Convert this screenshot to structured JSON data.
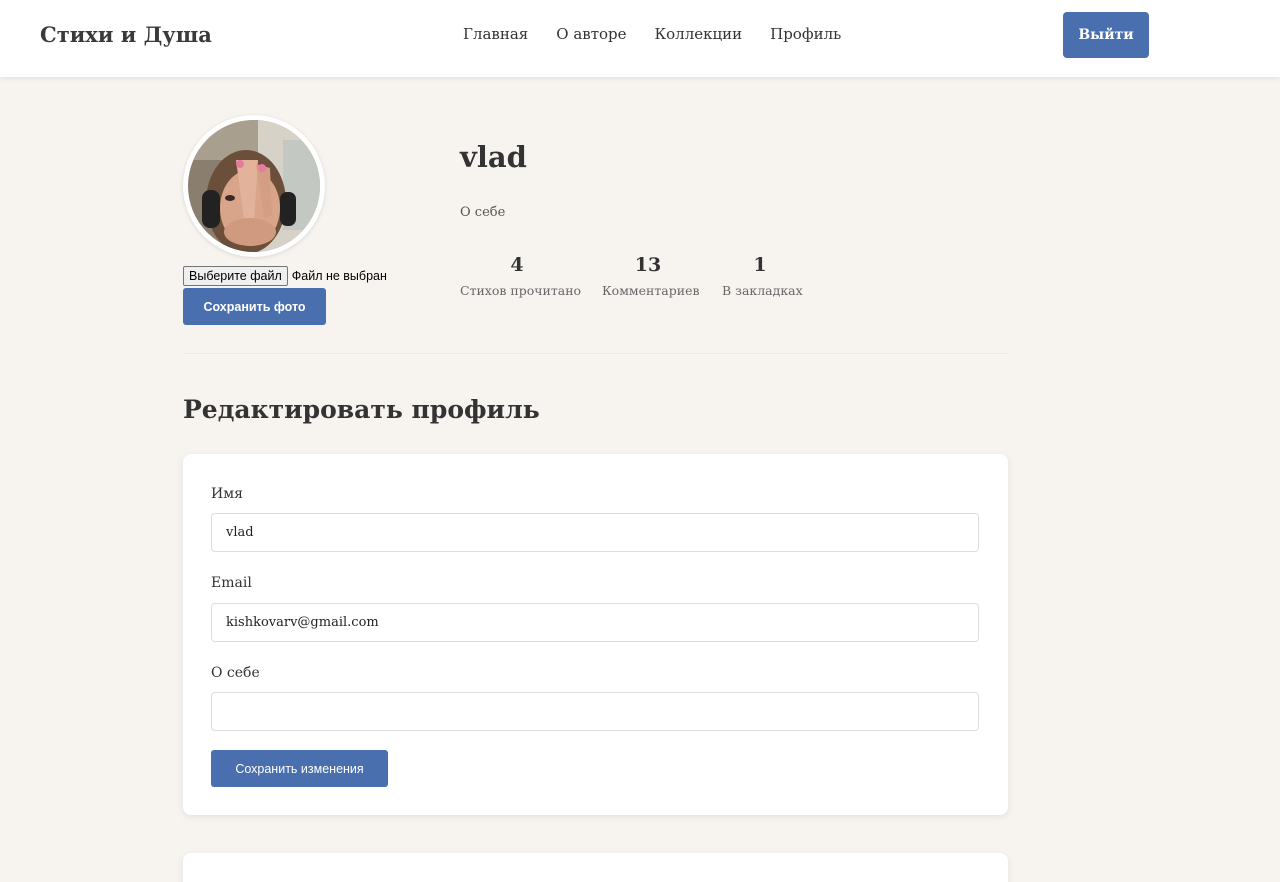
{
  "header": {
    "logo": "Стихи и Душа",
    "nav": [
      "Главная",
      "О авторе",
      "Коллекции",
      "Профиль"
    ],
    "logout_label": "Выйти"
  },
  "profile": {
    "avatar_icon": "user-photo",
    "file_button_label": "Выберите файл",
    "file_status": "Файл не выбран",
    "save_photo_label": "Сохранить фото",
    "username": "vlad",
    "bio": "О себе",
    "stats": [
      {
        "value": "4",
        "label": "Стихов прочитано"
      },
      {
        "value": "13",
        "label": "Комментариев"
      },
      {
        "value": "1",
        "label": "В закладках"
      }
    ]
  },
  "edit": {
    "title": "Редактировать профиль",
    "name_label": "Имя",
    "name_value": "vlad",
    "email_label": "Email",
    "email_value": "kishkovarv@gmail.com",
    "bio_label": "О себе",
    "bio_value": "",
    "save_label": "Сохранить изменения"
  },
  "colors": {
    "accent": "#4a6fae",
    "background": "#f7f4f0"
  }
}
